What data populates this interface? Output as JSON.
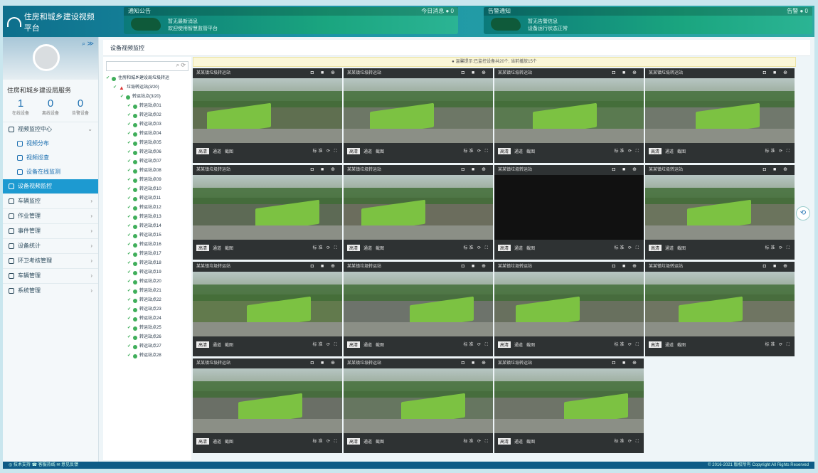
{
  "app": {
    "title": "住房和城乡建设视频平台"
  },
  "notices": [
    {
      "title": "通知公告",
      "meta": "今日消息 ● 0",
      "line1": "暂无最新消息",
      "line2": "欢迎使用智慧监管平台"
    },
    {
      "title": "告警通知",
      "meta": "告警 ● 0",
      "line1": "暂无告警信息",
      "line2": "设备运行状态正常"
    }
  ],
  "user": {
    "name": "住房和城乡建设局服务",
    "counts": [
      {
        "n": "1",
        "t": "在线设备"
      },
      {
        "n": "0",
        "t": "离线设备"
      },
      {
        "n": "0",
        "t": "告警设备"
      }
    ]
  },
  "menu": [
    {
      "label": "视频监控中心",
      "type": "group",
      "arrow": "⌄"
    },
    {
      "label": "视频分布",
      "type": "sub"
    },
    {
      "label": "视频巡查",
      "type": "sub"
    },
    {
      "label": "设备在线监测",
      "type": "sub"
    },
    {
      "label": "设备视频监控",
      "type": "active"
    },
    {
      "label": "车辆监控",
      "type": "group",
      "arrow": "›"
    },
    {
      "label": "作业管理",
      "type": "group",
      "arrow": "›"
    },
    {
      "label": "事件管理",
      "type": "group",
      "arrow": "›"
    },
    {
      "label": "设备统计",
      "type": "group",
      "arrow": "›"
    },
    {
      "label": "环卫考核管理",
      "type": "group",
      "arrow": "›"
    },
    {
      "label": "车辆管理",
      "type": "group",
      "arrow": "›"
    },
    {
      "label": "系统管理",
      "type": "group",
      "arrow": "›"
    }
  ],
  "breadcrumb": "设备视频监控",
  "tree": [
    {
      "label": "住房和城乡建设局垃圾转运",
      "level": 0,
      "kind": "dot"
    },
    {
      "label": "垃圾转运站(3/20)",
      "level": 1,
      "kind": "warn"
    },
    {
      "label": "转运站点(3/20)",
      "level": 2,
      "kind": "dot"
    },
    {
      "label": "转运站点01",
      "level": 3,
      "kind": "dot"
    },
    {
      "label": "转运站点02",
      "level": 3,
      "kind": "dot"
    },
    {
      "label": "转运站点03",
      "level": 3,
      "kind": "dot"
    },
    {
      "label": "转运站点04",
      "level": 3,
      "kind": "dot"
    },
    {
      "label": "转运站点05",
      "level": 3,
      "kind": "dot"
    },
    {
      "label": "转运站点06",
      "level": 3,
      "kind": "dot"
    },
    {
      "label": "转运站点07",
      "level": 3,
      "kind": "dot"
    },
    {
      "label": "转运站点08",
      "level": 3,
      "kind": "dot"
    },
    {
      "label": "转运站点09",
      "level": 3,
      "kind": "dot"
    },
    {
      "label": "转运站点10",
      "level": 3,
      "kind": "dot"
    },
    {
      "label": "转运站点11",
      "level": 3,
      "kind": "dot"
    },
    {
      "label": "转运站点12",
      "level": 3,
      "kind": "dot"
    },
    {
      "label": "转运站点13",
      "level": 3,
      "kind": "dot"
    },
    {
      "label": "转运站点14",
      "level": 3,
      "kind": "dot"
    },
    {
      "label": "转运站点15",
      "level": 3,
      "kind": "dot"
    },
    {
      "label": "转运站点16",
      "level": 3,
      "kind": "dot"
    },
    {
      "label": "转运站点17",
      "level": 3,
      "kind": "dot"
    },
    {
      "label": "转运站点18",
      "level": 3,
      "kind": "dot"
    },
    {
      "label": "转运站点19",
      "level": 3,
      "kind": "dot"
    },
    {
      "label": "转运站点20",
      "level": 3,
      "kind": "dot"
    },
    {
      "label": "转运站点21",
      "level": 3,
      "kind": "dot"
    },
    {
      "label": "转运站点22",
      "level": 3,
      "kind": "dot"
    },
    {
      "label": "转运站点23",
      "level": 3,
      "kind": "dot"
    },
    {
      "label": "转运站点24",
      "level": 3,
      "kind": "dot"
    },
    {
      "label": "转运站点25",
      "level": 3,
      "kind": "dot"
    },
    {
      "label": "转运站点26",
      "level": 3,
      "kind": "dot"
    },
    {
      "label": "转运站点27",
      "level": 3,
      "kind": "dot"
    },
    {
      "label": "转运站点28",
      "level": 3,
      "kind": "dot"
    }
  ],
  "info": "● 温馨提示:已监控设备共20个, 当前播放15个",
  "cells": [
    {
      "title": "某某镇垃圾转运站",
      "bg": "#5f6f50"
    },
    {
      "title": "某某镇垃圾转运站",
      "bg": "#6d7766"
    },
    {
      "title": "某某镇垃圾转运站",
      "bg": "#5a7a50"
    },
    {
      "title": "某某镇垃圾转运站",
      "bg": "#70786c"
    },
    {
      "title": "某某镇垃圾转运站",
      "bg": "#5d6a55"
    },
    {
      "title": "某某镇垃圾转运站",
      "bg": "#6b6d5d"
    },
    {
      "title": "某某镇垃圾转运站",
      "bg": "#111111"
    },
    {
      "title": "某某镇垃圾转运站",
      "bg": "#6b745d"
    },
    {
      "title": "某某镇垃圾转运站",
      "bg": "#627a4d"
    },
    {
      "title": "某某镇垃圾转运站",
      "bg": "#6d736b"
    },
    {
      "title": "某某镇垃圾转运站",
      "bg": "#68705e"
    },
    {
      "title": "某某镇垃圾转运站",
      "bg": "#6f7562"
    },
    {
      "title": "某某镇垃圾转运站",
      "bg": "#6a6f66"
    },
    {
      "title": "某某镇垃圾转运站",
      "bg": "#667660"
    },
    {
      "title": "某某镇垃圾转运站",
      "bg": "#6e7468"
    }
  ],
  "cell_toolbar": {
    "select": "高清",
    "a": "通道",
    "b": "截图",
    "right": "标准 ⟳ ⛶"
  },
  "cell_icons": "◘ ■ ⊕",
  "footer": {
    "left": "◎ 技术支持  ☎ 客服热线  ✉ 意见反馈",
    "right": "© 2016-2021 版权所有 Copyright All Rights Reserved"
  }
}
